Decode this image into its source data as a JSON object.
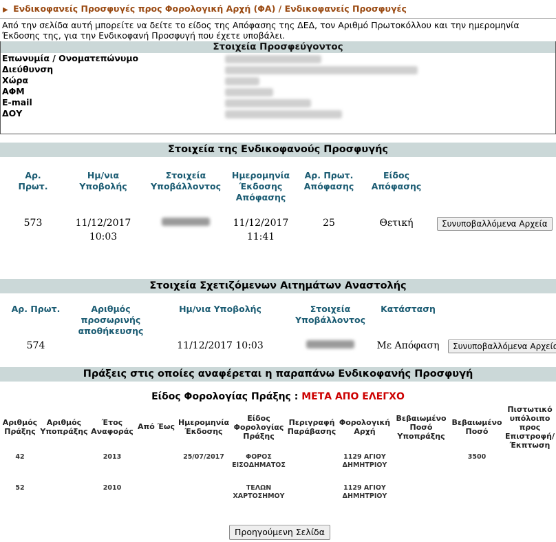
{
  "breadcrumb": "Ενδικοφανείς Προσφυγές προς Φορολογική Αρχή (ΦΑ) / Ενδικοφανείς Προσφυγές",
  "intro": "Από την σελίδα αυτή μπορείτε να δείτε το είδος της Απόφασης της ΔΕΔ, τον Αριθμό Πρωτοκόλλου και την ημερομηνία Έκδοσης της, για την Ενδικοφανή Προσφυγή που έχετε υποβάλει.",
  "appellant": {
    "title": "Στοιχεία Προσφεύγοντος",
    "labels": [
      "Επωνυμία / Ονοματεπώνυμο",
      "Διεύθυνση",
      "Χώρα",
      "ΑΦΜ",
      "E-mail",
      "ΔΟΥ"
    ]
  },
  "appeal": {
    "title": "Στοιχεία της Ενδικοφανούς Προσφυγής",
    "headers": [
      "Αρ. Πρωτ.",
      "Ημ/νια Υποβολής",
      "Στοιχεία Υποβάλλοντος",
      "Ημερομηνία Έκδοσης Απόφασης",
      "Αρ. Πρωτ. Απόφασης",
      "Είδος Απόφασης"
    ],
    "row": {
      "protocol": "573",
      "submit_date": "11/12/2017",
      "submit_time": "10:03",
      "issue_date": "11/12/2017",
      "issue_time": "11:41",
      "decision_protocol": "25",
      "decision_type": "Θετική",
      "files_button": "Συνυποβαλλόμενα Αρχεία"
    }
  },
  "suspension": {
    "title": "Στοιχεία Σχετιζόμενων Αιτημάτων Αναστολής",
    "headers": [
      "Αρ. Πρωτ.",
      "Αριθμός προσωρινής αποθήκευσης",
      "Ημ/νια Υποβολής",
      "Στοιχεία Υποβάλλοντος",
      "Κατάσταση"
    ],
    "row": {
      "protocol": "574",
      "submit_datetime": "11/12/2017 10:03",
      "status": "Με Απόφαση",
      "files_button": "Συνυποβαλλόμενα Αρχεία"
    }
  },
  "acts": {
    "title": "Πράξεις στις οποίες αναφέρεται η παραπάνω Ενδικοφανής Προσφυγή",
    "tax_type_label": "Είδος Φορολογίας Πράξης :",
    "tax_type_value": "ΜΕΤΑ ΑΠΟ ΕΛΕΓΧΟ",
    "headers": [
      "Αριθμός Πράξης",
      "Αριθμός Υποπράξης",
      "Έτος Αναφοράς",
      "Από Έως",
      "Ημερομηνία Έκδοσης",
      "Είδος Φορολογίας Πράξης",
      "Περιγραφή Παράβασης",
      "Φορολογική Αρχή",
      "Βεβαιωμένο Ποσό Υποπράξης",
      "Βεβαιωμένο Ποσό",
      "Πιστωτικό υπόλοιπο προς Επιστροφή/ Έκπτωση"
    ],
    "rows": [
      {
        "act": "42",
        "year": "2013",
        "issue_date": "25/07/2017",
        "tax_kind": "ΦΟΡΟΣ ΕΙΣΟΔΗΜΑΤΟΣ",
        "authority": "1129 ΑΓΙΟΥ ΔΗΜΗΤΡΙΟΥ",
        "amount": "3500"
      },
      {
        "act": "52",
        "year": "2010",
        "issue_date": "",
        "tax_kind": "ΤΕΛΩΝ ΧΑΡΤΟΣΗΜΟΥ",
        "authority": "1129 ΑΓΙΟΥ ΔΗΜΗΤΡΙΟΥ",
        "amount": ""
      }
    ]
  },
  "back_button": "Προηγούμενη Σελίδα",
  "colors": {
    "header_bar": "#cbd8d8",
    "breadcrumb": "#9a4a12",
    "column_header": "#1a5b72",
    "tax_value": "#cc0000"
  }
}
